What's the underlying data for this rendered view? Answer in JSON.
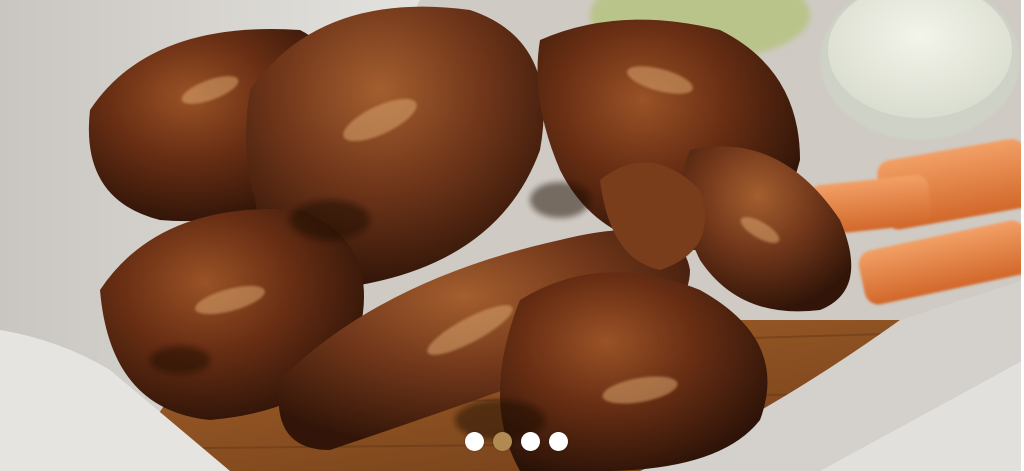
{
  "carousel": {
    "image_subject": "chicken-wings-with-carrots-and-dip",
    "slide_count": 4,
    "active_index": 1,
    "colors": {
      "dot_inactive": "#ffffff",
      "dot_active": "#b08a52",
      "sauce_glaze": "#6a2f14",
      "carrot": "#e07a3a",
      "paper": "#d8d6d2",
      "board": "#8a4f22"
    }
  }
}
